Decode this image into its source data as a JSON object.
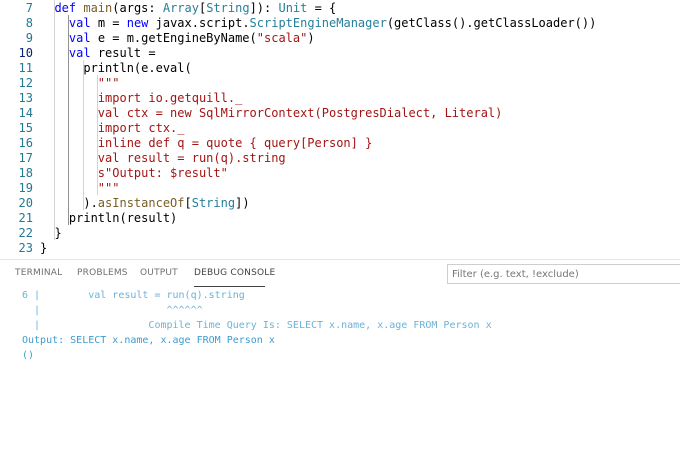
{
  "editor": {
    "lines": [
      {
        "num": "7",
        "segments": [
          {
            "t": "  ",
            "c": "#000000"
          },
          {
            "t": "def ",
            "c": "#0000ff"
          },
          {
            "t": "main",
            "c": "#795e26"
          },
          {
            "t": "(args: ",
            "c": "#000000"
          },
          {
            "t": "Array",
            "c": "#267f99"
          },
          {
            "t": "[",
            "c": "#000000"
          },
          {
            "t": "String",
            "c": "#267f99"
          },
          {
            "t": "]): ",
            "c": "#000000"
          },
          {
            "t": "Unit",
            "c": "#267f99"
          },
          {
            "t": " = {",
            "c": "#000000"
          }
        ]
      },
      {
        "num": "8",
        "segments": [
          {
            "t": "    ",
            "c": "#000000"
          },
          {
            "t": "val ",
            "c": "#0000ff"
          },
          {
            "t": "m = ",
            "c": "#000000"
          },
          {
            "t": "new ",
            "c": "#0000ff"
          },
          {
            "t": "javax.script.",
            "c": "#000000"
          },
          {
            "t": "ScriptEngineManager",
            "c": "#267f99"
          },
          {
            "t": "(getClass().getClassLoader())",
            "c": "#000000"
          }
        ]
      },
      {
        "num": "9",
        "segments": [
          {
            "t": "    ",
            "c": "#000000"
          },
          {
            "t": "val ",
            "c": "#0000ff"
          },
          {
            "t": "e = m.getEngineByName(",
            "c": "#000000"
          },
          {
            "t": "\"scala\"",
            "c": "#a31515"
          },
          {
            "t": ")",
            "c": "#000000"
          }
        ]
      },
      {
        "num": "10",
        "segments": [
          {
            "t": "    ",
            "c": "#000000"
          },
          {
            "t": "val ",
            "c": "#0000ff"
          },
          {
            "t": "result =",
            "c": "#000000"
          }
        ]
      },
      {
        "num": "11",
        "segments": [
          {
            "t": "      println(e.eval(",
            "c": "#000000"
          }
        ]
      },
      {
        "num": "12",
        "segments": [
          {
            "t": "        \"\"\"",
            "c": "#a31515"
          }
        ]
      },
      {
        "num": "13",
        "segments": [
          {
            "t": "        import io.getquill._",
            "c": "#a31515"
          }
        ]
      },
      {
        "num": "14",
        "segments": [
          {
            "t": "        val ctx = new SqlMirrorContext(PostgresDialect, Literal)",
            "c": "#a31515"
          }
        ]
      },
      {
        "num": "15",
        "segments": [
          {
            "t": "        import ctx._",
            "c": "#a31515"
          }
        ]
      },
      {
        "num": "16",
        "segments": [
          {
            "t": "        inline def q = quote { query[Person] }",
            "c": "#a31515"
          }
        ]
      },
      {
        "num": "17",
        "segments": [
          {
            "t": "        val result = run(q).string",
            "c": "#a31515"
          }
        ]
      },
      {
        "num": "18",
        "segments": [
          {
            "t": "        s\"Output: $result\"",
            "c": "#a31515"
          }
        ]
      },
      {
        "num": "19",
        "segments": [
          {
            "t": "        \"\"\"",
            "c": "#a31515"
          }
        ]
      },
      {
        "num": "20",
        "segments": [
          {
            "t": "      ).",
            "c": "#000000"
          },
          {
            "t": "asInstanceOf",
            "c": "#795e26"
          },
          {
            "t": "[",
            "c": "#000000"
          },
          {
            "t": "String",
            "c": "#267f99"
          },
          {
            "t": "])",
            "c": "#000000"
          }
        ]
      },
      {
        "num": "21",
        "segments": [
          {
            "t": "    println(result)",
            "c": "#000000"
          }
        ]
      },
      {
        "num": "22",
        "segments": [
          {
            "t": "  }",
            "c": "#000000"
          }
        ]
      },
      {
        "num": "23",
        "segments": [
          {
            "t": "}",
            "c": "#000000"
          }
        ]
      }
    ]
  },
  "panel": {
    "tabs": {
      "terminal": "TERMINAL",
      "problems": "PROBLEMS",
      "output": "OUTPUT",
      "debug_console": "DEBUG CONSOLE"
    },
    "active_tab": "debug_console",
    "filter_placeholder": "Filter (e.g. text, !exclude)",
    "console_lines": [
      "6 |        val result = run(q).string",
      "  |                     ^^^^^^",
      "  |                  Compile Time Query Is: SELECT x.name, x.age FROM Person x",
      "Output: SELECT x.name, x.age FROM Person x",
      "()"
    ]
  },
  "colors": {
    "keyword": "#0000ff",
    "type": "#267f99",
    "function": "#795e26",
    "string": "#a31515",
    "line_number": "#237893",
    "console_text": "#3e9bd1"
  }
}
